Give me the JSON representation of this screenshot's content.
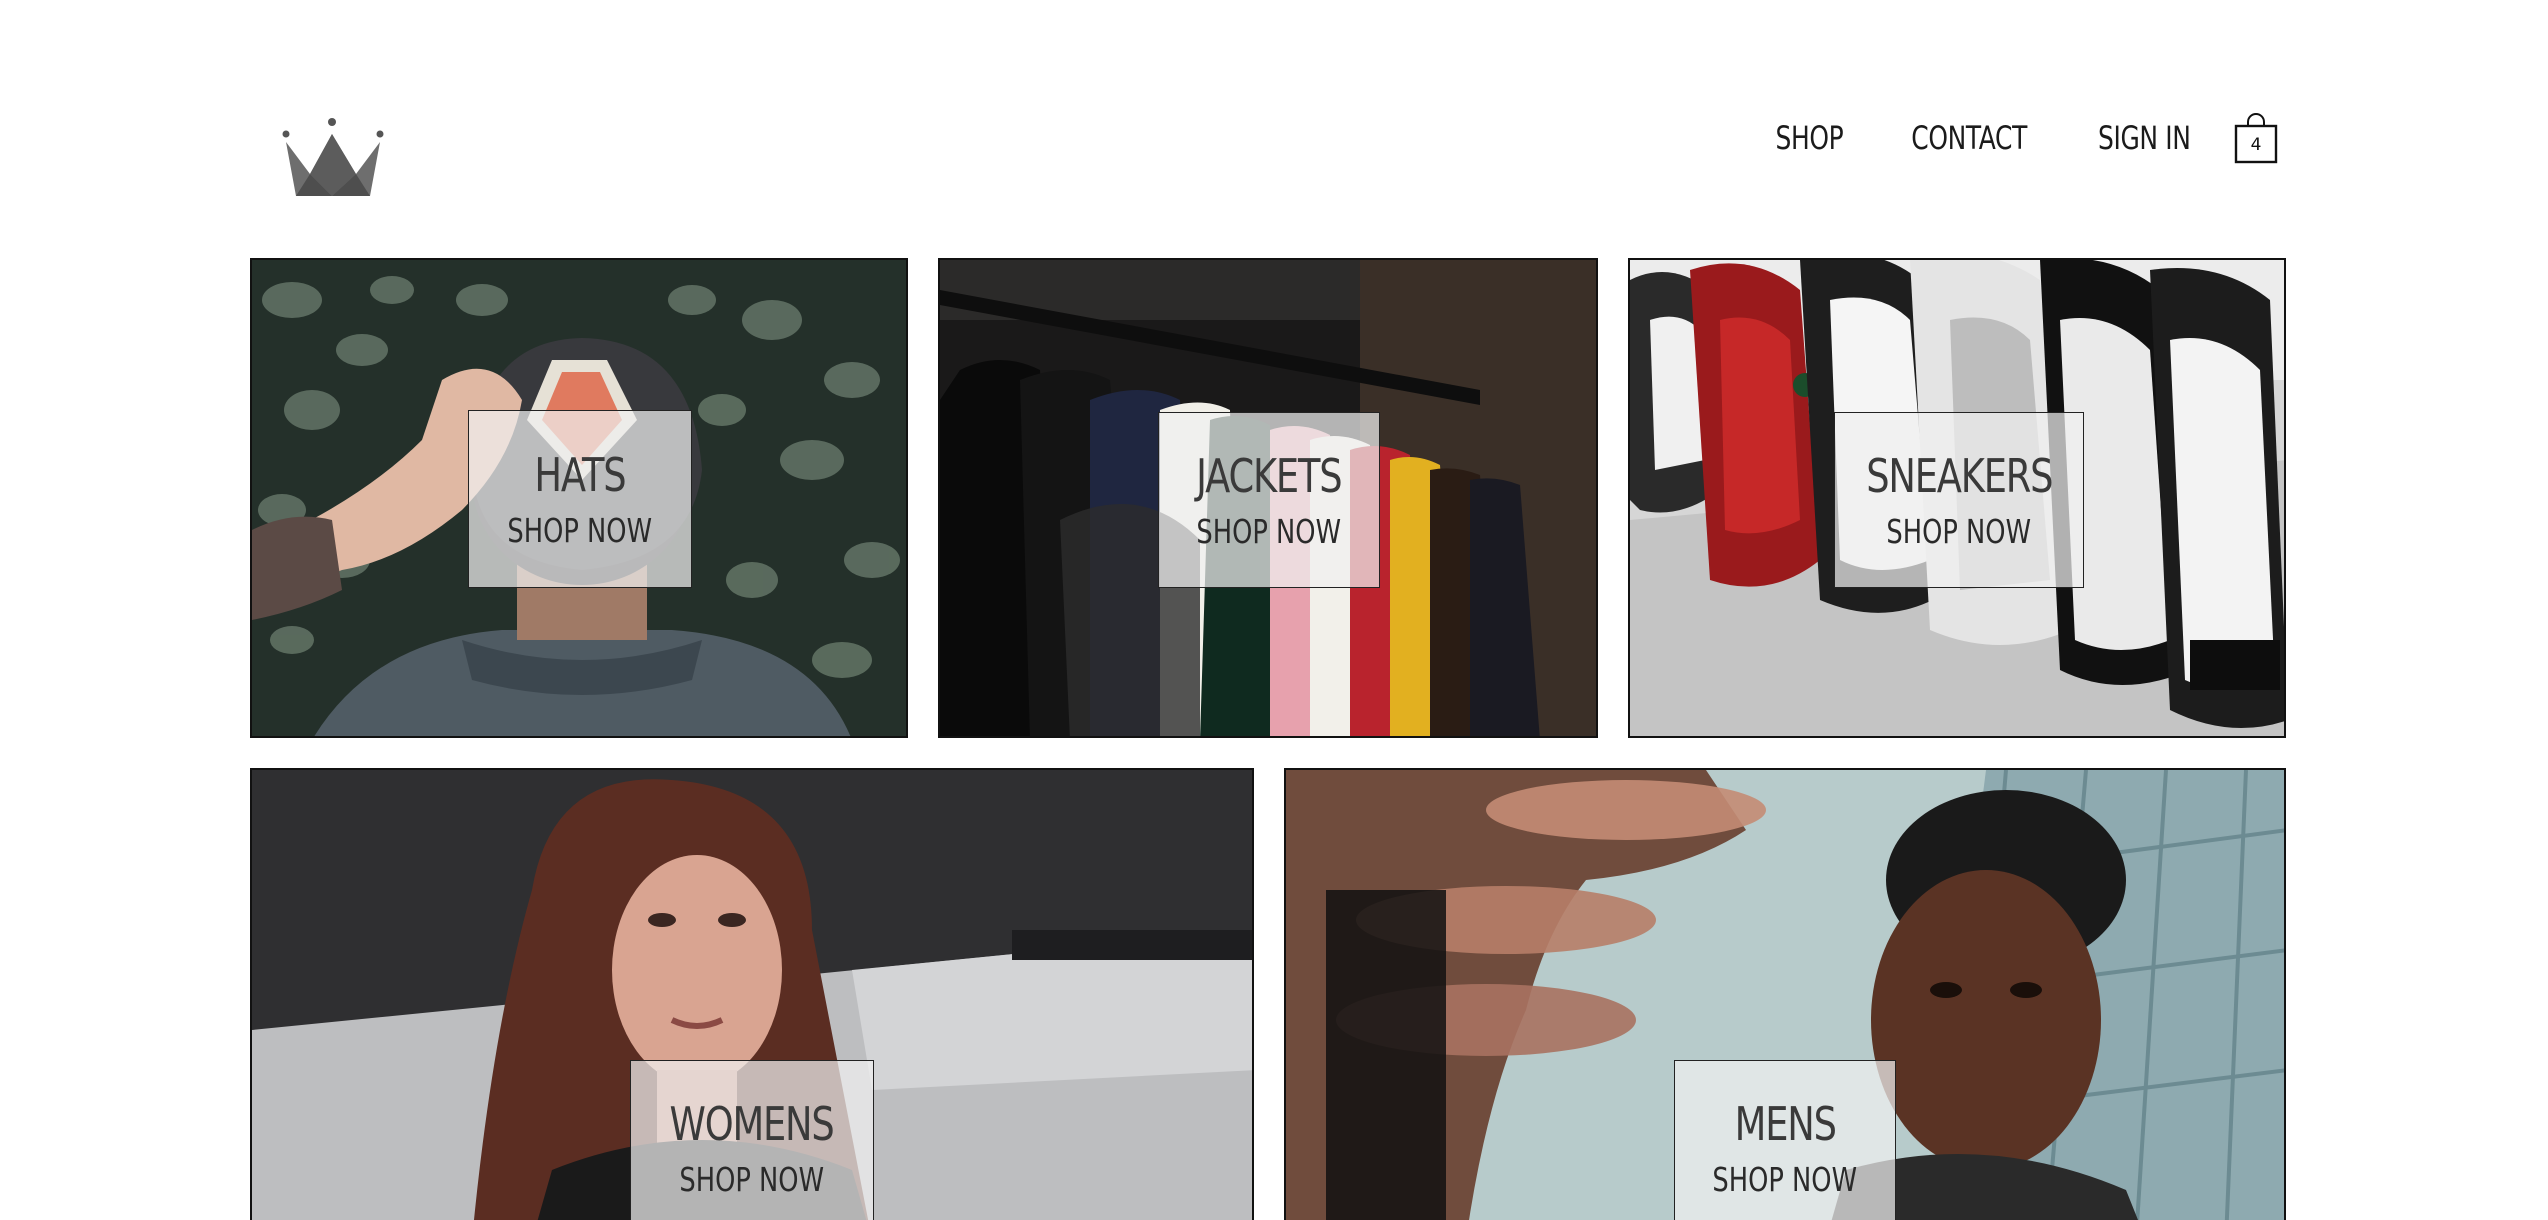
{
  "header": {
    "logo_icon": "crown-icon",
    "nav": {
      "shop": "SHOP",
      "contact": "CONTACT",
      "sign_in": "SIGN IN"
    },
    "cart": {
      "icon": "shopping-bag-icon",
      "count": "4"
    }
  },
  "categories": [
    {
      "title": "HATS",
      "cta": "SHOP NOW"
    },
    {
      "title": "JACKETS",
      "cta": "SHOP NOW"
    },
    {
      "title": "SNEAKERS",
      "cta": "SHOP NOW"
    },
    {
      "title": "WOMENS",
      "cta": "SHOP NOW"
    },
    {
      "title": "MENS",
      "cta": "SHOP NOW"
    }
  ]
}
